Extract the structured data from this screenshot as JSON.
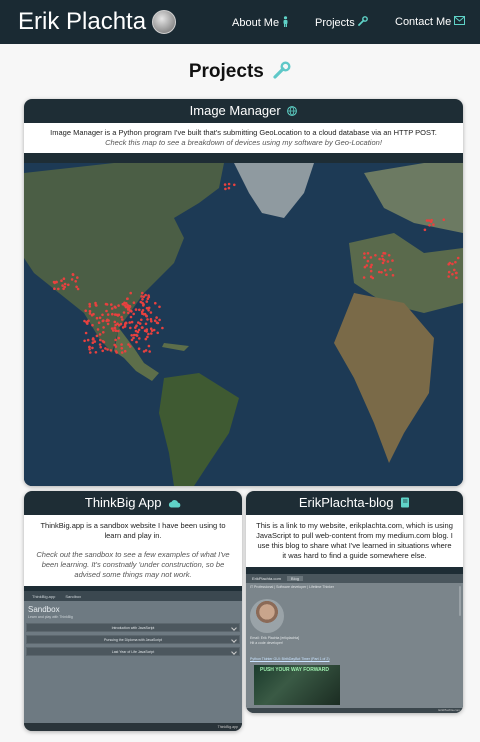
{
  "navbar": {
    "brand": "Erik Plachta",
    "links": [
      {
        "label": "About Me",
        "icon": "person-icon"
      },
      {
        "label": "Projects",
        "icon": "wrench-icon"
      },
      {
        "label": "Contact Me",
        "icon": "envelope-icon"
      }
    ]
  },
  "page": {
    "title": "Projects",
    "title_icon": "wrench-icon"
  },
  "projects": [
    {
      "title": "Image Manager",
      "icon": "globe-icon",
      "description": "Image Manager is a Python program I've built that's submitting GeoLocation to a cloud database via an HTTP POST.",
      "note": "Check this map to see a breakdown of devices using my software by Geo-Location!"
    },
    {
      "title": "ThinkBig App",
      "icon": "cloud-icon",
      "description": "ThinkBig.app is a sandbox website I have been using to learn and play in.",
      "note": "Check out the sandbox to see a few examples of what I've been learning. It's constnatly 'under construction, so be advised some things may not work.",
      "preview": {
        "nav_items": [
          "ThinkBig.app",
          "Sandbox"
        ],
        "heading": "Sandbox",
        "subheading": "Learn and play with ThinkBig",
        "rows": [
          "Introduction with JavaScript",
          "Pursuing the Diploma with JavaScript",
          "Last Year of Life JavaScript"
        ],
        "footer": "ThinkBig.app"
      }
    },
    {
      "title": "ErikPlachta-blog",
      "icon": "book-icon",
      "description": "This is a link to my website, erikplachta.com, which is using JavaScript to pull web-content from my medium.com blog. I use this blog to share what I've learned in situations where it was hard to find a guide somewhere else.",
      "preview": {
        "nav_items": [
          "ErikPlachta.com",
          "Blog"
        ],
        "banner": "IT Professional | Software developer | Lifetime Thinker",
        "caption_lines": [
          "Email: Erik Plachta [erikplachta]",
          "Hit a code developer!"
        ],
        "link": "Python Tkinter GUI: BirthDayBot Timer (Part 1 of 2)",
        "image_text": "PUSH YOUR WAY FORWARD",
        "footer": "ErikPlachta.com"
      }
    }
  ],
  "colors": {
    "navbar": "#1a2a33",
    "card": "#1e2d35",
    "accent": "#5fd3c8",
    "map_points": "#e8413f"
  }
}
